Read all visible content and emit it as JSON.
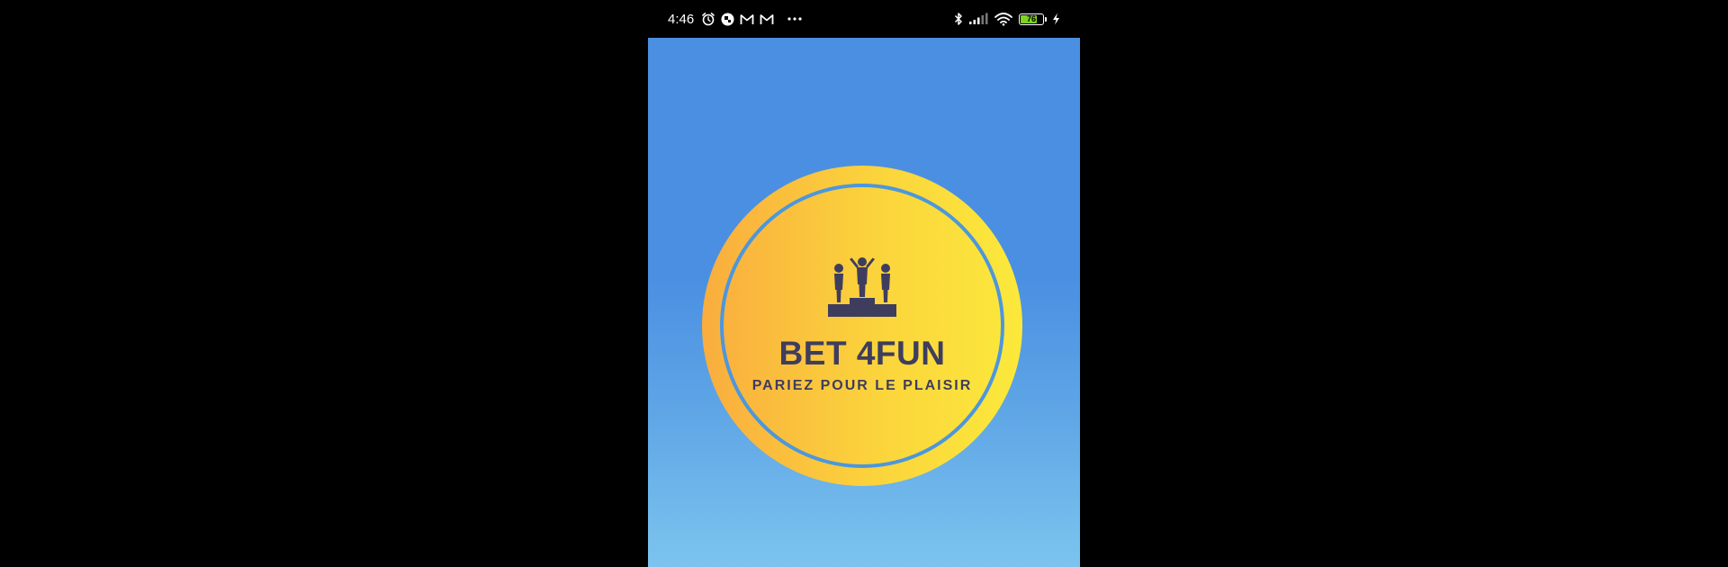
{
  "status_bar": {
    "time": "4:46",
    "battery_level": "76",
    "battery_percent": 76,
    "icons_left": [
      "alarm-icon",
      "app-notification-icon",
      "gmail-icon",
      "gmail-icon",
      "more-dots-icon"
    ],
    "icons_right": [
      "bluetooth-icon",
      "cellular-signal-icon",
      "wifi-icon",
      "battery-icon",
      "charging-icon"
    ]
  },
  "splash": {
    "brand_name": "BET 4FUN",
    "tagline": "PARIEZ POUR LE PLAISIR",
    "logo_icon": "podium-icon"
  },
  "colors": {
    "background_top": "#4a8fe2",
    "background_bottom": "#7cc4ee",
    "logo_gradient_left": "#f9ad3e",
    "logo_gradient_right": "#fbe93b",
    "logo_ring": "#4c97dd",
    "logo_text": "#3f3d5e",
    "battery_fill": "#7ed321"
  }
}
